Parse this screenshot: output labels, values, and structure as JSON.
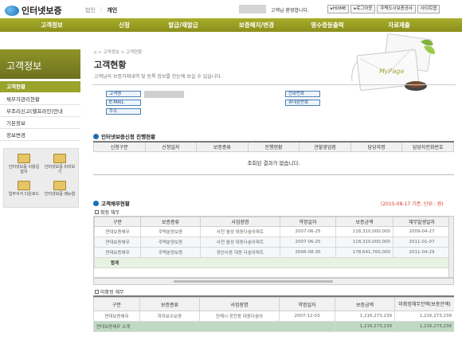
{
  "header": {
    "logo_text": "인터넷보증",
    "tab_corp": "법인",
    "tab_personal": "개인",
    "welcome": "고객님 환영합니다.",
    "buttons": [
      "HOME",
      "로그아웃",
      "주택도시보증공사",
      "사이트맵"
    ]
  },
  "gnb": [
    "고객정보",
    "신청",
    "발급/재발급",
    "보증해지/변경",
    "영수증등출력",
    "자료제출"
  ],
  "sidebar": {
    "title": "고객정보",
    "items": [
      "고객현황",
      "채무자관리현황",
      "부조리신고(헬프라인)안내",
      "기본정보",
      "정보변경"
    ],
    "quick": [
      {
        "label": "인터넷보증 이용길잡이"
      },
      {
        "label": "인터넷보증 미리보기"
      },
      {
        "label": "업무서식 다운로드"
      },
      {
        "label": "인터넷보증 매뉴얼"
      }
    ]
  },
  "page": {
    "breadcrumb": "⌂ > 고객정보 > 고객현황",
    "title": "고객현황",
    "description": "고객님의 보증거래내역 및 등록 정보를 한눈에 보실 수 있습니다.",
    "mypage_label": "MyPage"
  },
  "info": {
    "labels_left": [
      "고객명",
      "E-MAIL",
      "주소"
    ],
    "labels_right": [
      "전화번호",
      "휴대폰번호"
    ]
  },
  "apply_status": {
    "title": "인터넷보증신청 진행현황",
    "columns": [
      "신청구분",
      "신청일자",
      "보증종류",
      "진행현황",
      "관할영업점",
      "담당자명",
      "담당자전화번호"
    ],
    "empty": "조회된 결과가 없습니다."
  },
  "debt": {
    "title": "고객채무현황",
    "note": "(2015-08-17 기준, 단위 : 원)",
    "confirmed": {
      "title": "확정 채무",
      "columns": [
        "구분",
        "보증종류",
        "사업장명",
        "약정일자",
        "보증금액",
        "채무발생일자"
      ],
      "rows": [
        [
          "연대보증채무",
          "주택분양보증",
          "사천 월성 대동다숲아파트",
          "2007-06-25",
          "118,310,000,000",
          "2009-04-27"
        ],
        [
          "연대보증채무",
          "주택분양보증",
          "사천 월성 대동다숲아파트",
          "2007-06-25",
          "118,310,000,000",
          "2011-01-07"
        ],
        [
          "연대보증채무",
          "주택분양보증",
          "경산사동 대동 다숲아파트",
          "2006-08-30",
          "178,641,760,000",
          "2011-04-29"
        ]
      ],
      "total_label": "합계"
    },
    "unconfirmed": {
      "title": "미확정 채무",
      "columns": [
        "구분",
        "보증종류",
        "사업장명",
        "약정일자",
        "보증금액",
        "미확정채무잔액(보증잔액)"
      ],
      "rows": [
        [
          "연대보증채무",
          "하자보수보증",
          "진해시 장천동 대동다숲아",
          "2007-12-03",
          "1,216,273,239",
          "1,216,273,239"
        ]
      ],
      "subtotal": [
        "연대보증채무 소계",
        "1,216,273,239",
        "1,216,273,239"
      ]
    }
  }
}
